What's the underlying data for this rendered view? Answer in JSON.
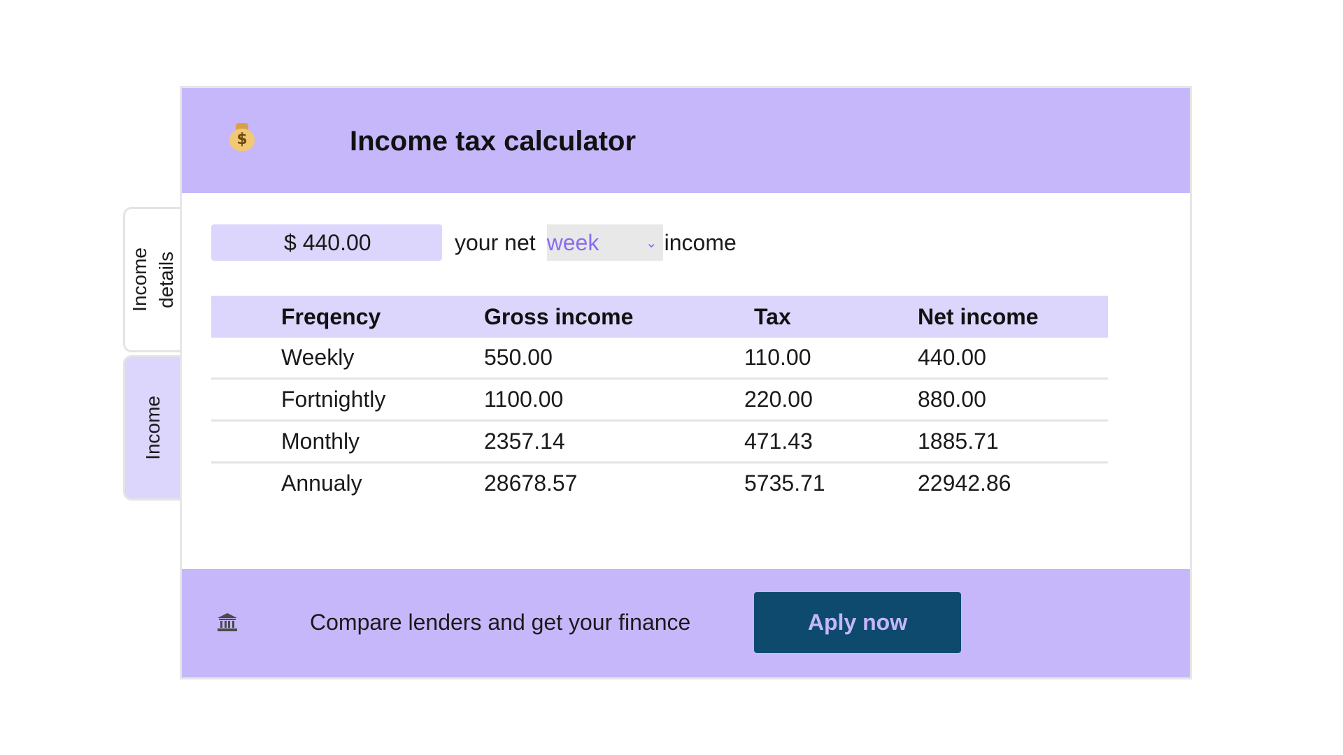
{
  "tabs": [
    {
      "label": "Income\ndetails",
      "active": true
    },
    {
      "label": "Income",
      "active": false
    }
  ],
  "header": {
    "icon": "money-bag-icon",
    "title": "Income tax calculator"
  },
  "controls": {
    "amount_value": "$ 440.00",
    "net_label": "your net",
    "period_value": "week",
    "income_label": "income"
  },
  "table": {
    "headers": [
      "Freqency",
      "Gross income",
      "Tax",
      "Net income"
    ],
    "rows": [
      [
        "Weekly",
        "550.00",
        "110.00",
        "440.00"
      ],
      [
        "Fortnightly",
        "1100.00",
        "220.00",
        "880.00"
      ],
      [
        "Monthly",
        "2357.14",
        "471.43",
        "1885.71"
      ],
      [
        "Annualy",
        "28678.57",
        "5735.71",
        "22942.86"
      ]
    ]
  },
  "footer": {
    "icon": "bank-icon",
    "text": "Compare lenders and get your finance",
    "button_label": "Aply now"
  },
  "colors": {
    "header_bg": "#c5b7fa",
    "light_purple": "#dcd5fc",
    "button_bg": "#0e4a6e",
    "accent": "#8b6cf0"
  }
}
